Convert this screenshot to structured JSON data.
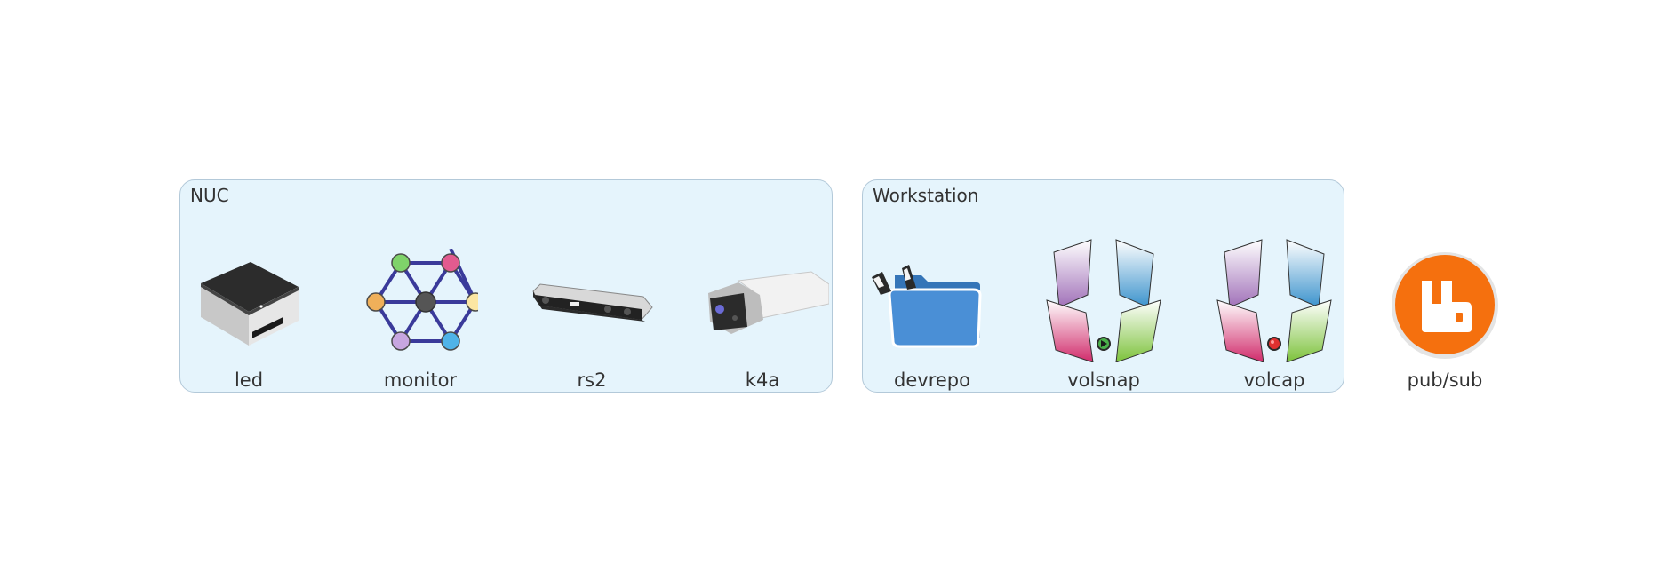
{
  "groups": [
    {
      "id": "nuc",
      "title": "NUC"
    },
    {
      "id": "workstation",
      "title": "Workstation"
    }
  ],
  "nodes": [
    {
      "id": "led",
      "label": "led",
      "icon": "mini-pc-icon",
      "group": "nuc"
    },
    {
      "id": "monitor",
      "label": "monitor",
      "icon": "network-graph-icon",
      "group": "nuc"
    },
    {
      "id": "rs2",
      "label": "rs2",
      "icon": "depth-camera-icon",
      "group": "nuc"
    },
    {
      "id": "k4a",
      "label": "k4a",
      "icon": "kinect-camera-icon",
      "group": "nuc"
    },
    {
      "id": "devrepo",
      "label": "devrepo",
      "icon": "folder-repo-icon",
      "group": "workstation"
    },
    {
      "id": "volsnap",
      "label": "volsnap",
      "icon": "volumetric-snap-icon",
      "group": "workstation",
      "status": "play"
    },
    {
      "id": "volcap",
      "label": "volcap",
      "icon": "volumetric-capture-icon",
      "group": "workstation",
      "status": "record"
    },
    {
      "id": "pubsub",
      "label": "pub/sub",
      "icon": "message-broker-icon",
      "group": null
    }
  ],
  "colors": {
    "group_fill": "#e5f4fc",
    "group_border": "#b3c9d9",
    "broker_orange": "#f5700e",
    "folder_blue": "#3e86c9",
    "graph_edge": "#3a3a9a"
  }
}
